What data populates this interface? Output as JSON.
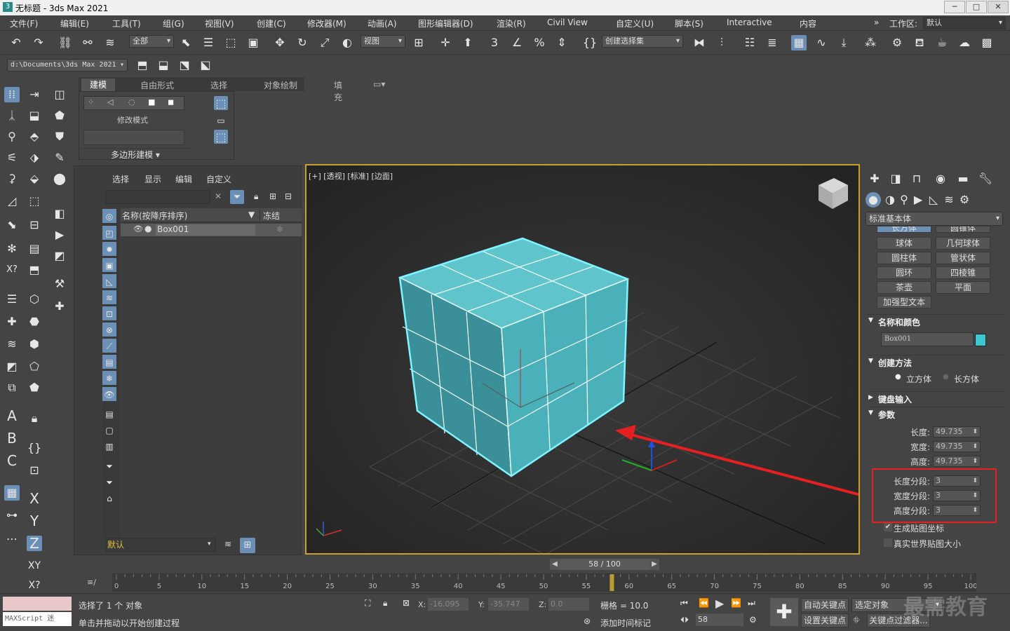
{
  "app": {
    "title": "无标题 - 3ds Max 2021",
    "workspace_label": "工作区:",
    "workspace_value": "默认"
  },
  "menu": [
    "文件(F)",
    "编辑(E)",
    "工具(T)",
    "组(G)",
    "视图(V)",
    "创建(C)",
    "修改器(M)",
    "动画(A)",
    "图形编辑器(D)",
    "渲染(R)",
    "Civil View",
    "自定义(U)",
    "脚本(S)",
    "Interactive",
    "内容"
  ],
  "toolbar": {
    "filter_value": "全部",
    "view_value": "视图",
    "selection_set_placeholder": "创建选择集",
    "project_path": "d:\\Documents\\3ds Max 2021"
  },
  "ribbon": {
    "tabs": [
      "建模",
      "自由形式",
      "选择",
      "对象绘制",
      "填充"
    ],
    "modify_mode": "修改模式",
    "poly_modeling": "多边形建模"
  },
  "scene_explorer": {
    "tabs": [
      "选择",
      "显示",
      "编辑",
      "自定义"
    ],
    "col_name": "名称(按降序排序)",
    "col_freeze": "冻结",
    "item": "Box001",
    "layer": "默认"
  },
  "viewport": {
    "label": "[+] [透视] [标准] [边面]"
  },
  "command_panel": {
    "category": "标准基本体",
    "top_partial": [
      "长方体",
      "圆锥体"
    ],
    "buttons": [
      "球体",
      "几何球体",
      "圆柱体",
      "管状体",
      "圆环",
      "四棱锥",
      "茶壶",
      "平面",
      "加强型文本"
    ],
    "name_color_title": "名称和颜色",
    "object_name": "Box001",
    "object_color": "#3cc8d2",
    "creation_method_title": "创建方法",
    "method_cube": "立方体",
    "method_box": "长方体",
    "keyboard_entry_title": "键盘输入",
    "params_title": "参数",
    "params": [
      {
        "label": "长度:",
        "value": "49.735"
      },
      {
        "label": "宽度:",
        "value": "49.735"
      },
      {
        "label": "高度:",
        "value": "49.735"
      }
    ],
    "segments": [
      {
        "label": "长度分段:",
        "value": "3"
      },
      {
        "label": "宽度分段:",
        "value": "3"
      },
      {
        "label": "高度分段:",
        "value": "3"
      }
    ],
    "gen_map": "生成贴图坐标",
    "real_world": "真实世界贴图大小"
  },
  "timeline": {
    "frame": "58 / 100",
    "ticks": [
      "0",
      "5",
      "10",
      "15",
      "20",
      "25",
      "30",
      "35",
      "40",
      "45",
      "50",
      "55",
      "60",
      "65",
      "70",
      "75",
      "80",
      "85",
      "90",
      "95",
      "100"
    ],
    "current": 58
  },
  "status": {
    "selected": "选择了 1 个 对象",
    "prompt": "单击并拖动以开始创建过程",
    "x_label": "X:",
    "x": "-16.095",
    "y_label": "Y:",
    "y": "-35.747",
    "z_label": "Z:",
    "z": "0.0",
    "grid": "栅格 = 10.0",
    "add_time_tag": "添加时间标记",
    "frame_field": "58",
    "auto_key": "自动关键点",
    "set_key": "设置关键点",
    "selected_obj": "选定对象",
    "key_filter": "关键点过滤器...",
    "maxscript": "MAXScript 迷",
    "watermark": "最需教育"
  }
}
